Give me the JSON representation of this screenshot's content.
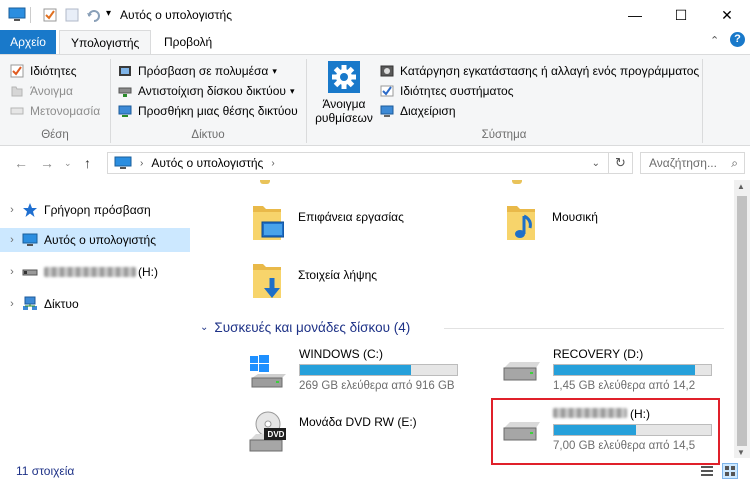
{
  "window": {
    "title": "Αυτός ο υπολογιστής",
    "controls": {
      "minimize": "—",
      "maximize": "☐",
      "close": "✕"
    }
  },
  "ribbon": {
    "tabs": [
      "Αρχείο",
      "Υπολογιστής",
      "Προβολή"
    ],
    "groups": {
      "location": {
        "label": "Θέση",
        "items": [
          "Ιδιότητες",
          "Άνοιγμα",
          "Μετονομασία"
        ]
      },
      "network": {
        "label": "Δίκτυο",
        "items": [
          "Πρόσβαση σε πολυμέσα",
          "Αντιστοίχιση δίσκου δικτύου",
          "Προσθήκη μιας θέσης δικτύου"
        ]
      },
      "system": {
        "label": "Σύστημα",
        "open_settings": [
          "Άνοιγμα",
          "ρυθμίσεων"
        ],
        "items": [
          "Κατάργηση εγκατάστασης ή αλλαγή ενός προγράμματος",
          "Ιδιότητες συστήματος",
          "Διαχείριση"
        ]
      }
    }
  },
  "address": {
    "path": "Αυτός ο υπολογιστής",
    "search_placeholder": "Αναζήτηση..."
  },
  "nav": {
    "items": [
      "Γρήγορη πρόσβαση",
      "Αυτός ο υπολογιστής",
      "(H:)",
      "Δίκτυο"
    ]
  },
  "content": {
    "folders": [
      "Επιφάνεια εργασίας",
      "Μουσική",
      "Στοιχεία λήψης"
    ],
    "devices_header": "Συσκευές και μονάδες δίσκου (4)",
    "drives": [
      {
        "name": "WINDOWS (C:)",
        "free": "269 GB ελεύθερα από 916 GB",
        "used_fraction": 0.71
      },
      {
        "name": "RECOVERY (D:)",
        "free": "1,45 GB ελεύθερα από 14,2",
        "used_fraction": 0.9
      },
      {
        "name": "Μονάδα DVD RW (E:)",
        "badge": "DVD"
      },
      {
        "name": "(H:)",
        "free": "7,00 GB ελεύθερα από 14,5",
        "used_fraction": 0.52
      }
    ]
  },
  "status": {
    "count": "11 στοιχεία"
  },
  "colors": {
    "accent": "#1979ca",
    "selection": "#cce8ff",
    "bar": "#26a0da",
    "highlight_box": "#e0202a"
  }
}
